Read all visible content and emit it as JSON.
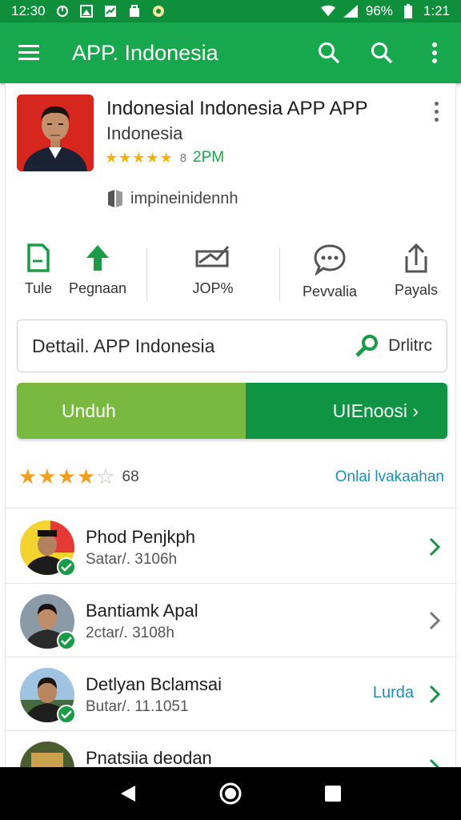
{
  "status_bar": {
    "time_left": "12:30",
    "battery": "96%",
    "time_right": "1:21"
  },
  "app_bar": {
    "title": "APP. Indonesia"
  },
  "app": {
    "title": "Indonesial Indonesia APP  APP",
    "subtitle": "Indonesia",
    "rating_badge": "8",
    "rating_count": "2PM",
    "developer": "impineinidennh"
  },
  "actions": [
    {
      "label": "Tule",
      "icon": "document-icon"
    },
    {
      "label": "Pegnaan",
      "icon": "arrow-up-icon"
    },
    {
      "label": "JOP%",
      "icon": "trend-icon"
    },
    {
      "label": "Pevvalia",
      "icon": "chat-icon"
    },
    {
      "label": "Payals",
      "icon": "share-icon"
    }
  ],
  "detail": {
    "text": "Dettail. APP Indonesia",
    "right_label": "Drlitrc"
  },
  "buttons": {
    "install": "Unduh",
    "open": "UIEnoosi ›"
  },
  "reviews_summary": {
    "count": "68",
    "see_all": "Onlai lvakaahan",
    "stars": 4
  },
  "reviews": [
    {
      "name": "Phod Penjkph",
      "meta": "Satar/. 3106h",
      "tag": ""
    },
    {
      "name": "Bantiamk Apal",
      "meta": "2ctar/. 3108h",
      "tag": ""
    },
    {
      "name": "Detlyan Bclamsai",
      "meta": "Butar/. 11.1051",
      "tag": "Lurda"
    },
    {
      "name": "Pnatsiia deodan",
      "meta": "",
      "tag": ""
    }
  ],
  "colors": {
    "status_bar": "#0f8f3c",
    "app_bar": "#17a74c",
    "install": "#79b940",
    "open": "#0e9442",
    "link": "#1b8fb3",
    "star": "#f29e1c"
  }
}
